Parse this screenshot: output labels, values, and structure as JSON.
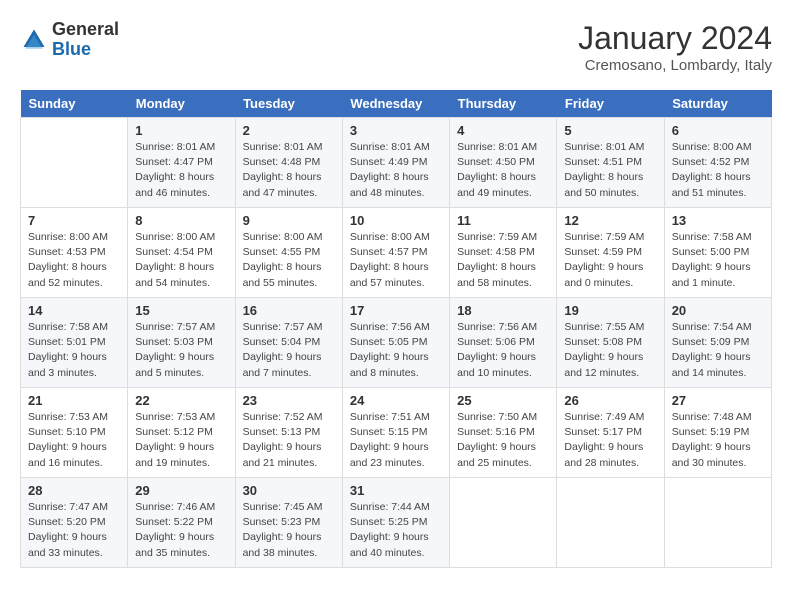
{
  "header": {
    "logo_line1": "General",
    "logo_line2": "Blue",
    "month": "January 2024",
    "location": "Cremosano, Lombardy, Italy"
  },
  "weekdays": [
    "Sunday",
    "Monday",
    "Tuesday",
    "Wednesday",
    "Thursday",
    "Friday",
    "Saturday"
  ],
  "weeks": [
    [
      {
        "day": "",
        "info": ""
      },
      {
        "day": "1",
        "info": "Sunrise: 8:01 AM\nSunset: 4:47 PM\nDaylight: 8 hours\nand 46 minutes."
      },
      {
        "day": "2",
        "info": "Sunrise: 8:01 AM\nSunset: 4:48 PM\nDaylight: 8 hours\nand 47 minutes."
      },
      {
        "day": "3",
        "info": "Sunrise: 8:01 AM\nSunset: 4:49 PM\nDaylight: 8 hours\nand 48 minutes."
      },
      {
        "day": "4",
        "info": "Sunrise: 8:01 AM\nSunset: 4:50 PM\nDaylight: 8 hours\nand 49 minutes."
      },
      {
        "day": "5",
        "info": "Sunrise: 8:01 AM\nSunset: 4:51 PM\nDaylight: 8 hours\nand 50 minutes."
      },
      {
        "day": "6",
        "info": "Sunrise: 8:00 AM\nSunset: 4:52 PM\nDaylight: 8 hours\nand 51 minutes."
      }
    ],
    [
      {
        "day": "7",
        "info": "Sunrise: 8:00 AM\nSunset: 4:53 PM\nDaylight: 8 hours\nand 52 minutes."
      },
      {
        "day": "8",
        "info": "Sunrise: 8:00 AM\nSunset: 4:54 PM\nDaylight: 8 hours\nand 54 minutes."
      },
      {
        "day": "9",
        "info": "Sunrise: 8:00 AM\nSunset: 4:55 PM\nDaylight: 8 hours\nand 55 minutes."
      },
      {
        "day": "10",
        "info": "Sunrise: 8:00 AM\nSunset: 4:57 PM\nDaylight: 8 hours\nand 57 minutes."
      },
      {
        "day": "11",
        "info": "Sunrise: 7:59 AM\nSunset: 4:58 PM\nDaylight: 8 hours\nand 58 minutes."
      },
      {
        "day": "12",
        "info": "Sunrise: 7:59 AM\nSunset: 4:59 PM\nDaylight: 9 hours\nand 0 minutes."
      },
      {
        "day": "13",
        "info": "Sunrise: 7:58 AM\nSunset: 5:00 PM\nDaylight: 9 hours\nand 1 minute."
      }
    ],
    [
      {
        "day": "14",
        "info": "Sunrise: 7:58 AM\nSunset: 5:01 PM\nDaylight: 9 hours\nand 3 minutes."
      },
      {
        "day": "15",
        "info": "Sunrise: 7:57 AM\nSunset: 5:03 PM\nDaylight: 9 hours\nand 5 minutes."
      },
      {
        "day": "16",
        "info": "Sunrise: 7:57 AM\nSunset: 5:04 PM\nDaylight: 9 hours\nand 7 minutes."
      },
      {
        "day": "17",
        "info": "Sunrise: 7:56 AM\nSunset: 5:05 PM\nDaylight: 9 hours\nand 8 minutes."
      },
      {
        "day": "18",
        "info": "Sunrise: 7:56 AM\nSunset: 5:06 PM\nDaylight: 9 hours\nand 10 minutes."
      },
      {
        "day": "19",
        "info": "Sunrise: 7:55 AM\nSunset: 5:08 PM\nDaylight: 9 hours\nand 12 minutes."
      },
      {
        "day": "20",
        "info": "Sunrise: 7:54 AM\nSunset: 5:09 PM\nDaylight: 9 hours\nand 14 minutes."
      }
    ],
    [
      {
        "day": "21",
        "info": "Sunrise: 7:53 AM\nSunset: 5:10 PM\nDaylight: 9 hours\nand 16 minutes."
      },
      {
        "day": "22",
        "info": "Sunrise: 7:53 AM\nSunset: 5:12 PM\nDaylight: 9 hours\nand 19 minutes."
      },
      {
        "day": "23",
        "info": "Sunrise: 7:52 AM\nSunset: 5:13 PM\nDaylight: 9 hours\nand 21 minutes."
      },
      {
        "day": "24",
        "info": "Sunrise: 7:51 AM\nSunset: 5:15 PM\nDaylight: 9 hours\nand 23 minutes."
      },
      {
        "day": "25",
        "info": "Sunrise: 7:50 AM\nSunset: 5:16 PM\nDaylight: 9 hours\nand 25 minutes."
      },
      {
        "day": "26",
        "info": "Sunrise: 7:49 AM\nSunset: 5:17 PM\nDaylight: 9 hours\nand 28 minutes."
      },
      {
        "day": "27",
        "info": "Sunrise: 7:48 AM\nSunset: 5:19 PM\nDaylight: 9 hours\nand 30 minutes."
      }
    ],
    [
      {
        "day": "28",
        "info": "Sunrise: 7:47 AM\nSunset: 5:20 PM\nDaylight: 9 hours\nand 33 minutes."
      },
      {
        "day": "29",
        "info": "Sunrise: 7:46 AM\nSunset: 5:22 PM\nDaylight: 9 hours\nand 35 minutes."
      },
      {
        "day": "30",
        "info": "Sunrise: 7:45 AM\nSunset: 5:23 PM\nDaylight: 9 hours\nand 38 minutes."
      },
      {
        "day": "31",
        "info": "Sunrise: 7:44 AM\nSunset: 5:25 PM\nDaylight: 9 hours\nand 40 minutes."
      },
      {
        "day": "",
        "info": ""
      },
      {
        "day": "",
        "info": ""
      },
      {
        "day": "",
        "info": ""
      }
    ]
  ]
}
